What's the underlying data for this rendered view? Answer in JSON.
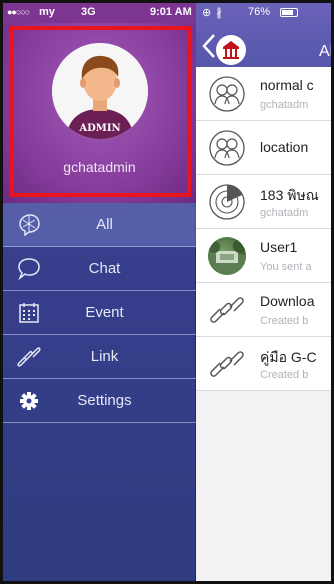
{
  "status_bar": {
    "signal": "●●○○○",
    "carrier": "my",
    "network": "3G",
    "time": "9:01 AM",
    "indicators": "⊕ ∦",
    "battery": "76%"
  },
  "profile": {
    "avatar_badge": "ADMIN",
    "username": "gchatadmin"
  },
  "menu": {
    "items": [
      {
        "label": "All",
        "icon": "globe-chat-icon"
      },
      {
        "label": "Chat",
        "icon": "speech-bubble-icon"
      },
      {
        "label": "Event",
        "icon": "calendar-icon"
      },
      {
        "label": "Link",
        "icon": "chain-link-icon"
      },
      {
        "label": "Settings",
        "icon": "gear-icon"
      }
    ]
  },
  "main": {
    "title": "All",
    "rooms": [
      {
        "title": "normal c",
        "subtitle": "gchatadm",
        "icon": "group-icon"
      },
      {
        "title": "location",
        "subtitle": "",
        "icon": "group-icon"
      },
      {
        "title": "183 พิษณ",
        "subtitle": "gchatadm",
        "icon": "radar-icon"
      },
      {
        "title": "User1",
        "subtitle": "You sent a",
        "icon": "user-photo"
      },
      {
        "title": "Downloa",
        "subtitle": "Created b",
        "icon": "chain-link-icon"
      },
      {
        "title": "คู่มือ G-C",
        "subtitle": "Created b",
        "icon": "chain-link-icon"
      }
    ]
  },
  "colors": {
    "profile_highlight": "#e8151d",
    "sidebar": "#383f8e",
    "header": "#5f5db2"
  }
}
